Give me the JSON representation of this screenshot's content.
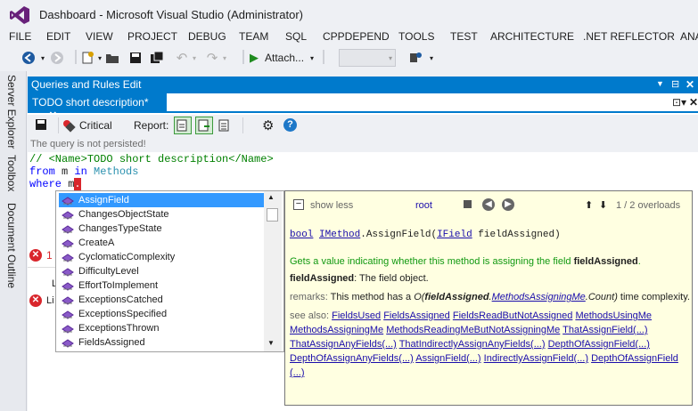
{
  "window": {
    "title": "Dashboard - Microsoft Visual Studio (Administrator)"
  },
  "menu": [
    "FILE",
    "EDIT",
    "VIEW",
    "PROJECT",
    "DEBUG",
    "TEAM",
    "SQL",
    "CPPDEPEND",
    "TOOLS",
    "TEST",
    "ARCHITECTURE",
    ".NET REFLECTOR",
    "ANA"
  ],
  "toolbar": {
    "attach_label": "Attach..."
  },
  "sidebar": {
    "tabs": [
      "Server Explorer",
      "Toolbox",
      "Document Outline"
    ]
  },
  "panel": {
    "title": "Queries and Rules Edit",
    "doc_tab": "TODO short description*"
  },
  "query_toolbar": {
    "critical_label": "Critical",
    "report_label": "Report:"
  },
  "notice": "The query is not persisted!",
  "code": {
    "line1_prefix": "// ",
    "line1_content": "<Name>TODO short description</Name>",
    "line2_kw1": "from",
    "line2_mid": " m ",
    "line2_kw2": "in",
    "line2_type": "Methods",
    "line3_kw": "where",
    "line3_mid": " m",
    "line3_cursor": "."
  },
  "errors": {
    "e1": "1",
    "e2": "Li"
  },
  "completion": {
    "items": [
      "AssignField",
      "ChangesObjectState",
      "ChangesTypeState",
      "CreateA",
      "CyclomaticComplexity",
      "DifficultyLevel",
      "EffortToImplement",
      "ExceptionsCatched",
      "ExceptionsSpecified",
      "ExceptionsThrown",
      "FieldsAssigned"
    ],
    "selected_index": 0
  },
  "tooltip": {
    "show_less": "show less",
    "root": "root",
    "overloads": "1 / 2 overloads",
    "sig_ret": "bool",
    "sig_owner": "IMethod",
    "sig_method": ".AssignField(",
    "sig_param_type": "IField",
    "sig_param": " fieldAssigned)",
    "summary_text": "Gets a value indicating whether this method is assigning the field ",
    "summary_bold": "fieldAssigned",
    "summary_end": ".",
    "param_name": "fieldAssigned",
    "param_desc": ": The field object.",
    "remarks_label": "remarks:",
    "remarks_text": " This method has a ",
    "remarks_formula_a": "O(",
    "remarks_formula_b": "fieldAssigned",
    "remarks_formula_c": ".",
    "remarks_formula_link": "MethodsAssigningMe",
    "remarks_formula_d": ".Count)",
    "remarks_end": " time complexity.",
    "see_also_label": "see also:",
    "see_also_lines": [
      [
        "FieldsUsed",
        "FieldsAssigned",
        "FieldsReadButNotAssigned",
        "MethodsUsingMe"
      ],
      [
        "MethodsAssigningMe",
        "MethodsReadingMeButNotAssigningMe",
        "ThatAssignField(...)"
      ],
      [
        "ThatAssignAnyFields(...)",
        "ThatIndirectlyAssignAnyFields(...)",
        "DepthOfAssignField(...)"
      ],
      [
        "DepthOfAssignAnyFields(...)",
        "AssignField(...)",
        "IndirectlyAssignField(...)",
        "DepthOfAssignField"
      ],
      [
        "(...)"
      ]
    ]
  },
  "colors": {
    "accent": "#007acc",
    "selection": "#3399ff",
    "keyword": "#0000ff",
    "comment": "#008000",
    "type": "#2b91af",
    "vs_purple": "#68217a"
  }
}
